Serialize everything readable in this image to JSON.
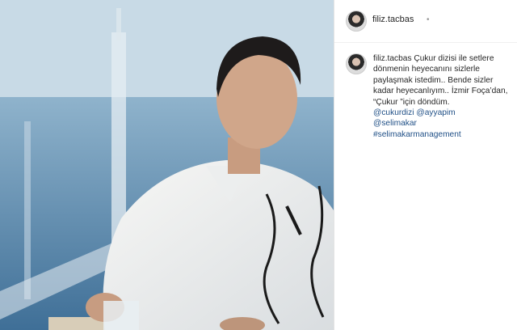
{
  "post": {
    "username": "filiz.tacbas",
    "header_dot": "•",
    "caption_user": "filiz.tacbas",
    "caption_text": "Çukur dizisi ile setlere dönmenin heyecanını sizlerle paylaşmak istedim.. Bende sizler kadar heyecanlıyım.. İzmir Foça’dan, “Çukur ”için döndüm.",
    "tags": [
      "@cukurdizi @ayyapim",
      "@selimakar",
      "#selimakarmanagement"
    ]
  },
  "colors": {
    "link": "#1f4f86",
    "text": "#262626"
  }
}
